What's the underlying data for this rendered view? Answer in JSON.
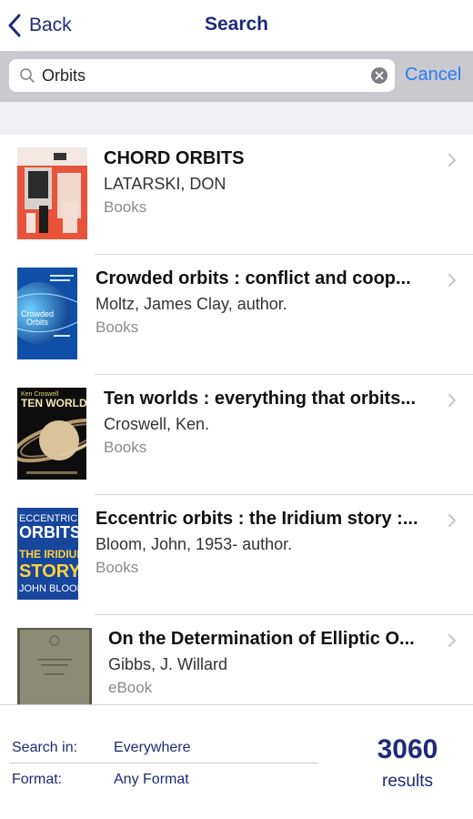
{
  "nav": {
    "back_label": "Back",
    "title": "Search"
  },
  "search": {
    "value": "Orbits",
    "cancel_label": "Cancel"
  },
  "results": [
    {
      "title": "CHORD ORBITS",
      "author": "LATARSKI, DON",
      "type": "Books"
    },
    {
      "title": "Crowded orbits : conflict and coop...",
      "author": "Moltz, James Clay, author.",
      "type": "Books"
    },
    {
      "title": "Ten worlds : everything that orbits...",
      "author": "Croswell, Ken.",
      "type": "Books"
    },
    {
      "title": "Eccentric orbits : the Iridium story :...",
      "author": "Bloom, John, 1953- author.",
      "type": "Books"
    },
    {
      "title": "On the Determination of Elliptic O...",
      "author": "Gibbs, J. Willard",
      "type": "eBook"
    }
  ],
  "covers": {
    "crowded": [
      "Crowded",
      "Orbits"
    ],
    "ten_worlds": [
      "Ken Croswell",
      "TEN WORLDS"
    ],
    "eccentric": [
      "ECCENTRIC",
      "ORBITS",
      "THE IRIDIUM",
      "STORY",
      "JOHN BLOOM"
    ]
  },
  "filters": {
    "search_in_label": "Search in:",
    "search_in_value": "Everywhere",
    "format_label": "Format:",
    "format_value": "Any Format"
  },
  "summary": {
    "count": "3060",
    "label": "results"
  },
  "colors": {
    "nav_blue": "#1f2a7a",
    "link_blue": "#2a7cf6",
    "search_bar_bg": "#c9c9ce",
    "muted": "#8a8a8f"
  },
  "icons": {
    "back": "chevron-left-icon",
    "search": "magnifier-icon",
    "clear": "clear-x-icon",
    "disclosure": "chevron-right-icon"
  }
}
